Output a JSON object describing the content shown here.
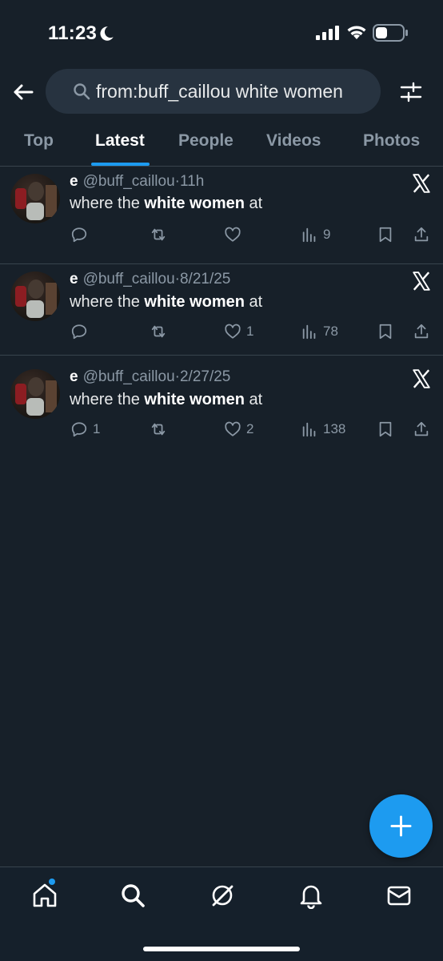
{
  "status_bar": {
    "time": "11:23"
  },
  "search": {
    "query": "from:buff_caillou white women"
  },
  "tabs": [
    {
      "label": "Top"
    },
    {
      "label": "Latest",
      "active": true
    },
    {
      "label": "People"
    },
    {
      "label": "Videos"
    },
    {
      "label": "Photos"
    }
  ],
  "tweets": [
    {
      "name": "e",
      "handle": "@buff_caillou",
      "dot": "·",
      "time": "11h",
      "text_pre": "where the ",
      "text_bold": "white women",
      "text_post": " at",
      "replies": "",
      "retweets": "",
      "likes": "",
      "views": "9"
    },
    {
      "name": "e",
      "handle": "@buff_caillou",
      "dot": "·",
      "time": "8/21/25",
      "text_pre": "where the ",
      "text_bold": "white women",
      "text_post": " at",
      "replies": "",
      "retweets": "",
      "likes": "1",
      "views": "78"
    },
    {
      "name": "e",
      "handle": "@buff_caillou",
      "dot": "·",
      "time": "2/27/25",
      "text_pre": "where the ",
      "text_bold": "white women",
      "text_post": " at",
      "replies": "1",
      "retweets": "",
      "likes": "2",
      "views": "138"
    }
  ],
  "icons": {
    "back": "arrow-left-icon",
    "search": "search-icon",
    "filter": "sliders-icon",
    "post_logo": "x-logo-icon",
    "compose": "plus-icon",
    "nav": [
      "home-icon",
      "search-icon",
      "grok-icon",
      "bell-icon",
      "mail-icon"
    ]
  },
  "colors": {
    "background": "#172029",
    "accent": "#1d9bf0",
    "muted_text": "#8b98a5",
    "divider": "#38444d"
  }
}
